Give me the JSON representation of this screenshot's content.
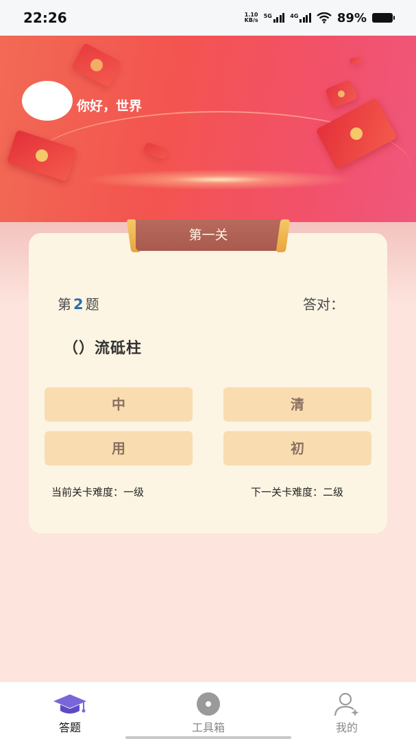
{
  "status_bar": {
    "time": "22:26",
    "net_speed_value": "1.10",
    "net_speed_unit": "KB/s",
    "signal_1": "5G",
    "signal_2": "4G",
    "battery": "89%"
  },
  "header": {
    "greeting": "你好，世界",
    "avatar_icon": "avatar-placeholder"
  },
  "quiz": {
    "level_title": "第一关",
    "question_prefix": "第",
    "question_number": "2",
    "question_suffix": "题",
    "correct_label": "答对：",
    "question_text": "（）流砥柱",
    "options": [
      "中",
      "清",
      "用",
      "初"
    ],
    "current_difficulty": "当前关卡难度：一级",
    "next_difficulty": "下一关卡难度：二级"
  },
  "bottom_nav": {
    "items": [
      {
        "label": "答题",
        "icon": "graduation-cap-icon",
        "active": true
      },
      {
        "label": "工具箱",
        "icon": "disc-icon",
        "active": false
      },
      {
        "label": "我的",
        "icon": "user-icon",
        "active": false
      }
    ]
  },
  "colors": {
    "accent": "#7a66d8",
    "banner": "#f3544f",
    "option_bg": "#f9ddb0",
    "card_bg": "#fdf5e4"
  }
}
